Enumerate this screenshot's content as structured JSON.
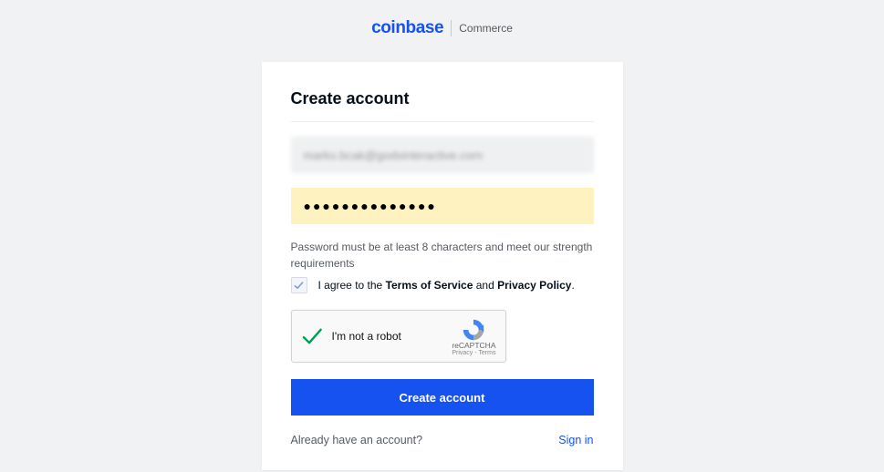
{
  "brand": {
    "main": "coinbase",
    "sub": "Commerce"
  },
  "card": {
    "title": "Create account",
    "email_value": "marko.bcak@godsinteractive.corn",
    "password_mask": "●●●●●●●●●●●●●●",
    "hint": "Password must be at least 8 characters and meet our strength requirements",
    "agree_prefix": "I agree to the ",
    "tos_label": "Terms of Service",
    "agree_and": " and ",
    "privacy_label": "Privacy Policy",
    "agree_suffix": ".",
    "recaptcha": {
      "label": "I'm not a robot",
      "name": "reCAPTCHA",
      "legal": "Privacy - Terms"
    },
    "submit_label": "Create account",
    "already_text": "Already have an account?",
    "signin_label": "Sign in"
  }
}
